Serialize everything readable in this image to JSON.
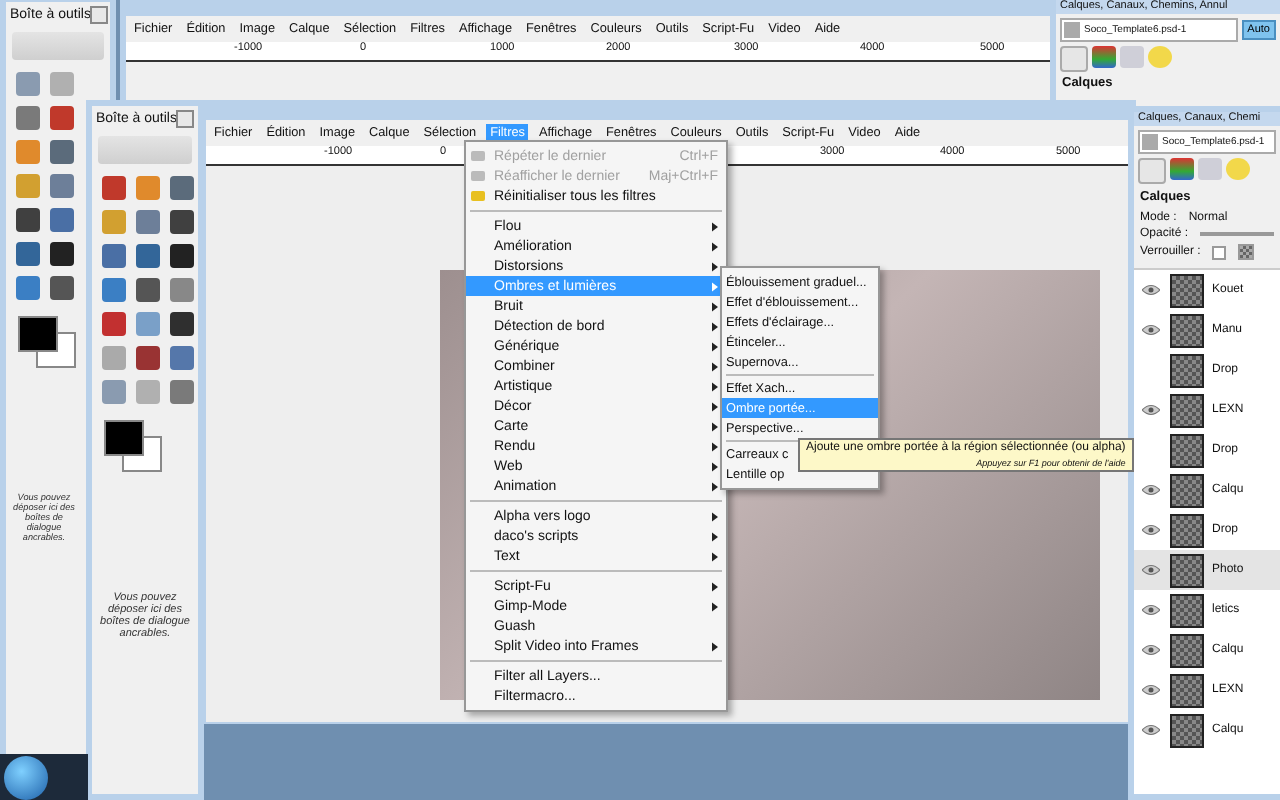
{
  "back_toolbox": {
    "title": "Boîte à outils",
    "hint": "Vous pouvez déposer ici des boîtes de dialogue ancrables."
  },
  "back_image_window": {
    "menu": [
      {
        "label": "Fichier",
        "selected": false
      },
      {
        "label": "Édition",
        "selected": false
      },
      {
        "label": "Image",
        "selected": false
      },
      {
        "label": "Calque",
        "selected": false
      },
      {
        "label": "Sélection",
        "selected": false
      },
      {
        "label": "Filtres",
        "selected": false
      },
      {
        "label": "Affichage",
        "selected": false
      },
      {
        "label": "Fenêtres",
        "selected": false
      },
      {
        "label": "Couleurs",
        "selected": false
      },
      {
        "label": "Outils",
        "selected": false
      },
      {
        "label": "Script-Fu",
        "selected": false
      },
      {
        "label": "Video",
        "selected": false
      },
      {
        "label": "Aide",
        "selected": false
      }
    ],
    "ruler_labels": [
      "-1000",
      "0",
      "1000",
      "2000",
      "3000",
      "4000",
      "5000"
    ]
  },
  "back_layers_dock": {
    "title": "Calques, Canaux, Chemins, Annul",
    "image": "Soco_Template6.psd-1",
    "auto_button": "Auto",
    "panel_title": "Calques"
  },
  "toolbox": {
    "title": "Boîte à outils",
    "hint": "Vous pouvez déposer ici des boîtes de dialogue ancrables."
  },
  "image_window": {
    "menu": [
      {
        "label": "Fichier",
        "selected": false
      },
      {
        "label": "Édition",
        "selected": false
      },
      {
        "label": "Image",
        "selected": false
      },
      {
        "label": "Calque",
        "selected": false
      },
      {
        "label": "Sélection",
        "selected": false
      },
      {
        "label": "Filtres",
        "selected": true
      },
      {
        "label": "Affichage",
        "selected": false
      },
      {
        "label": "Fenêtres",
        "selected": false
      },
      {
        "label": "Couleurs",
        "selected": false
      },
      {
        "label": "Outils",
        "selected": false
      },
      {
        "label": "Script-Fu",
        "selected": false
      },
      {
        "label": "Video",
        "selected": false
      },
      {
        "label": "Aide",
        "selected": false
      }
    ],
    "ruler_labels": [
      "-1000",
      "0",
      "3000",
      "4000",
      "5000"
    ]
  },
  "filters_menu": {
    "sections": [
      [
        {
          "kind": "with_icon",
          "label": "Répéter le dernier",
          "shortcut": "Ctrl+F",
          "disabled": true,
          "selected": false
        },
        {
          "kind": "with_icon",
          "label": "Réafficher le dernier",
          "shortcut": "Maj+Ctrl+F",
          "disabled": true,
          "selected": false
        },
        {
          "kind": "with_icon",
          "label": "Réinitialiser tous les filtres",
          "disabled": false,
          "selected": false
        }
      ],
      [
        {
          "kind": "submenu",
          "label": "Flou",
          "disabled": false,
          "selected": false
        },
        {
          "kind": "submenu",
          "label": "Amélioration",
          "disabled": false,
          "selected": false
        },
        {
          "kind": "submenu",
          "label": "Distorsions",
          "disabled": false,
          "selected": false
        },
        {
          "kind": "submenu",
          "label": "Ombres et lumières",
          "disabled": false,
          "selected": true
        },
        {
          "kind": "submenu",
          "label": "Bruit",
          "disabled": false,
          "selected": false
        },
        {
          "kind": "submenu",
          "label": "Détection de bord",
          "disabled": false,
          "selected": false
        },
        {
          "kind": "submenu",
          "label": "Générique",
          "disabled": false,
          "selected": false
        },
        {
          "kind": "submenu",
          "label": "Combiner",
          "disabled": false,
          "selected": false
        },
        {
          "kind": "submenu",
          "label": "Artistique",
          "disabled": false,
          "selected": false
        },
        {
          "kind": "submenu",
          "label": "Décor",
          "disabled": false,
          "selected": false
        },
        {
          "kind": "submenu",
          "label": "Carte",
          "disabled": false,
          "selected": false
        },
        {
          "kind": "submenu",
          "label": "Rendu",
          "disabled": false,
          "selected": false
        },
        {
          "kind": "submenu",
          "label": "Web",
          "disabled": false,
          "selected": false
        },
        {
          "kind": "submenu",
          "label": "Animation",
          "disabled": false,
          "selected": false
        }
      ],
      [
        {
          "kind": "submenu",
          "label": "Alpha vers logo",
          "disabled": false,
          "selected": false
        },
        {
          "kind": "submenu",
          "label": "daco's scripts",
          "disabled": false,
          "selected": false
        },
        {
          "kind": "submenu",
          "label": "Text",
          "disabled": false,
          "selected": false
        }
      ],
      [
        {
          "kind": "submenu",
          "label": "Script-Fu",
          "disabled": false,
          "selected": false
        },
        {
          "kind": "submenu",
          "label": "Gimp-Mode",
          "disabled": false,
          "selected": false
        },
        {
          "kind": "plain",
          "label": "Guash",
          "disabled": false,
          "selected": false
        },
        {
          "kind": "submenu",
          "label": "Split Video into Frames",
          "disabled": false,
          "selected": false
        }
      ],
      [
        {
          "kind": "plain",
          "label": "Filter all Layers...",
          "disabled": false,
          "selected": false
        },
        {
          "kind": "plain",
          "label": "Filtermacro...",
          "disabled": false,
          "selected": false
        }
      ]
    ]
  },
  "submenu": {
    "sections": [
      [
        {
          "label": "Éblouissement graduel...",
          "selected": false
        },
        {
          "label": "Effet d'éblouissement...",
          "selected": false
        },
        {
          "label": "Effets d'éclairage...",
          "selected": false
        },
        {
          "label": "Étinceler...",
          "selected": false
        },
        {
          "label": "Supernova...",
          "selected": false
        }
      ],
      [
        {
          "label": "Effet Xach...",
          "selected": false
        },
        {
          "label": "Ombre portée...",
          "selected": true
        },
        {
          "label": "Perspective...",
          "selected": false
        }
      ],
      [
        {
          "label": "Carreaux c",
          "selected": false
        },
        {
          "label": "Lentille op",
          "selected": false
        }
      ]
    ]
  },
  "tooltip": {
    "text": "Ajoute une ombre portée à la région sélectionnée (ou alpha)",
    "help": "Appuyez sur F1 pour obtenir de l'aide"
  },
  "layers_dock": {
    "title": "Calques, Canaux, Chemi",
    "image": "Soco_Template6.psd-1",
    "panel_title": "Calques",
    "mode_label": "Mode :",
    "mode": "Normal",
    "opacity": {
      "label": "Opacité :",
      "level": 1
    },
    "lock_label": "Verrouiller :",
    "lock_checked": false,
    "layers": [
      {
        "name": "Kouet",
        "visible": true,
        "selected": false
      },
      {
        "name": "Manu",
        "visible": true,
        "selected": false
      },
      {
        "name": "Drop",
        "visible": false,
        "selected": false
      },
      {
        "name": "LEXN",
        "visible": true,
        "selected": false
      },
      {
        "name": "Drop",
        "visible": false,
        "selected": false
      },
      {
        "name": "Calqu",
        "visible": true,
        "selected": false
      },
      {
        "name": "Drop",
        "visible": true,
        "selected": false
      },
      {
        "name": "Photo",
        "visible": true,
        "selected": true
      },
      {
        "name": "letics",
        "visible": true,
        "selected": false
      },
      {
        "name": "Calqu",
        "visible": true,
        "selected": false
      },
      {
        "name": "LEXN",
        "visible": true,
        "selected": false
      },
      {
        "name": "Calqu",
        "visible": true,
        "selected": false
      }
    ]
  }
}
